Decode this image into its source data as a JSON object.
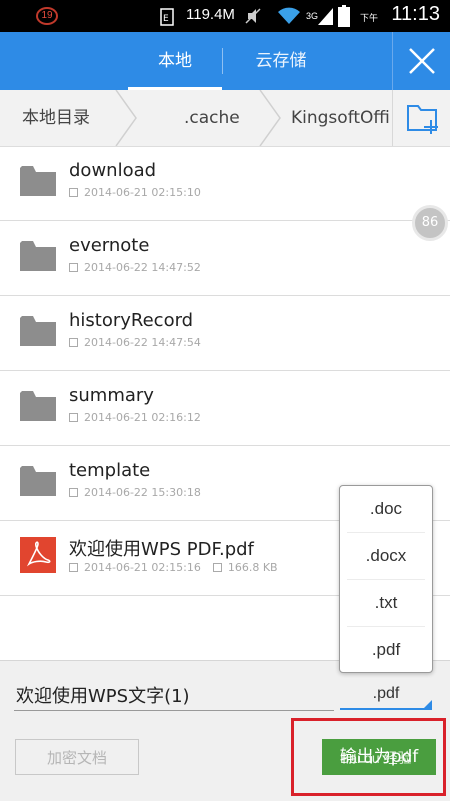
{
  "status_bar": {
    "notification_count": "19",
    "data_usage": "119.4M",
    "network_label": "3G",
    "ampm": "下午",
    "time": "11:13"
  },
  "header": {
    "tabs": [
      {
        "label": "本地",
        "active": true
      },
      {
        "label": "云存储",
        "active": false
      }
    ]
  },
  "breadcrumb": {
    "items": [
      "本地目录",
      ".cache",
      "KingsoftOffi"
    ]
  },
  "files": [
    {
      "name": "download",
      "date": "2014-06-21 02:15:10",
      "type": "folder"
    },
    {
      "name": "evernote",
      "date": "2014-06-22 14:47:52",
      "type": "folder"
    },
    {
      "name": "historyRecord",
      "date": "2014-06-22 14:47:54",
      "type": "folder"
    },
    {
      "name": "summary",
      "date": "2014-06-21 02:16:12",
      "type": "folder"
    },
    {
      "name": "template",
      "date": "2014-06-22 15:30:18",
      "type": "folder"
    },
    {
      "name": "欢迎使用WPS PDF.pdf",
      "date": "2014-06-21 02:15:16",
      "size": "166.8 KB",
      "type": "pdf"
    }
  ],
  "floating_badge": "86",
  "extension_dropdown": {
    "options": [
      ".doc",
      ".docx",
      ".txt",
      ".pdf"
    ]
  },
  "bottom": {
    "filename_value": "欢迎使用WPS文字(1)",
    "selected_extension": ".pdf",
    "encrypt_label": "加密文档",
    "export_label": "输出为pdf",
    "watermark_text": "Bai du 经验"
  },
  "colors": {
    "header_blue": "#2e8be6",
    "export_green": "#4a9e3f",
    "pdf_red": "#e1452f",
    "highlight_red": "#d9212a"
  }
}
